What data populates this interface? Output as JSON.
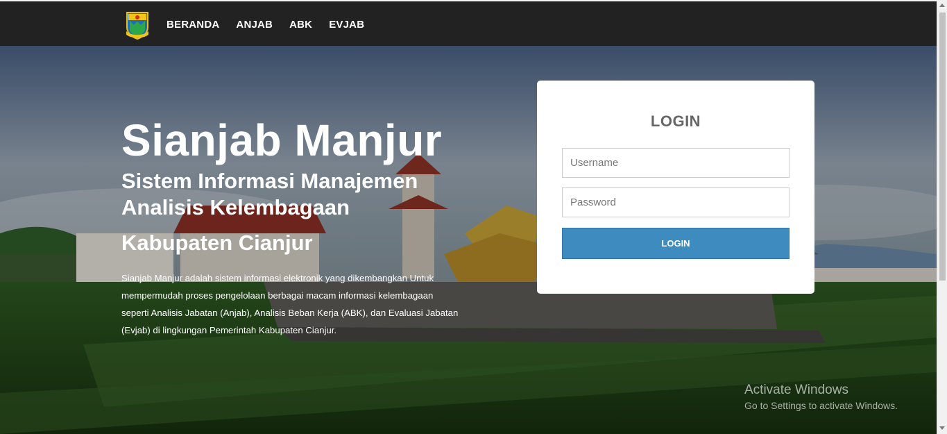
{
  "nav": {
    "logo_icon": "cianjur-regency-emblem-icon",
    "links": [
      "BERANDA",
      "ANJAB",
      "ABK",
      "EVJAB"
    ]
  },
  "hero": {
    "title": "Sianjab Manjur",
    "subtitle": "Sistem Informasi Manajemen Analisis Kelembagaan",
    "region": "Kabupaten Cianjur",
    "description": "Sianjab Manjur adalah sistem informasi elektronik yang dikembangkan Untuk mempermudah proses pengelolaan berbagai macam informasi kelembagaan seperti Analisis Jabatan (Anjab), Analisis Beban Kerja (ABK), dan Evaluasi Jabatan (Evjab) di lingkungan Pemerintah Kabupaten Cianjur."
  },
  "login": {
    "title": "LOGIN",
    "username_placeholder": "Username",
    "password_placeholder": "Password",
    "button_label": "LOGIN",
    "button_color": "#3d8bbf"
  },
  "watermark": {
    "title": "Activate Windows",
    "subtitle": "Go to Settings to activate Windows."
  },
  "colors": {
    "navbar": "#222222",
    "accent": "#3d8bbf"
  }
}
